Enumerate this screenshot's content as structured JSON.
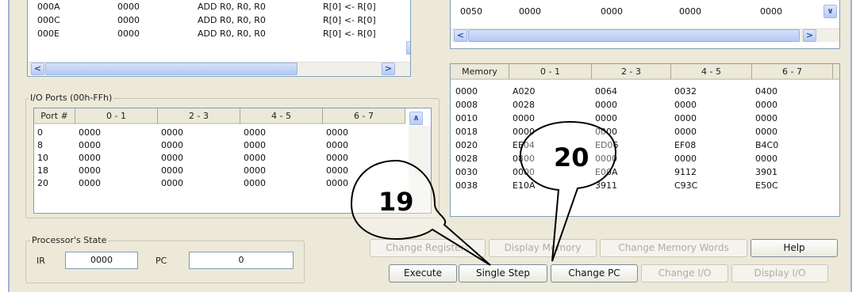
{
  "code_panel": {
    "rows": [
      {
        "addr": "000A",
        "code": "0000",
        "instr": "ADD R0, R0, R0",
        "desc": "R[0] <- R[0]"
      },
      {
        "addr": "000C",
        "code": "0000",
        "instr": "ADD R0, R0, R0",
        "desc": "R[0] <- R[0]"
      },
      {
        "addr": "000E",
        "code": "0000",
        "instr": "ADD R0, R0, R0",
        "desc": "R[0] <- R[0]"
      }
    ]
  },
  "reg_panel": {
    "row": [
      "0050",
      "0000",
      "0000",
      "0000",
      "0000"
    ]
  },
  "io_ports": {
    "title": "I/O Ports (00h-FFh)",
    "headers": [
      "Port #",
      "0 - 1",
      "2 - 3",
      "4 - 5",
      "6 - 7"
    ],
    "rows": [
      [
        "0",
        "0000",
        "0000",
        "0000",
        "0000"
      ],
      [
        "8",
        "0000",
        "0000",
        "0000",
        "0000"
      ],
      [
        "10",
        "0000",
        "0000",
        "0000",
        "0000"
      ],
      [
        "18",
        "0000",
        "0000",
        "0000",
        "0000"
      ],
      [
        "20",
        "0000",
        "0000",
        "0000",
        "0000"
      ]
    ]
  },
  "memory": {
    "headers": [
      "Memory",
      "0 - 1",
      "2 - 3",
      "4 - 5",
      "6 - 7"
    ],
    "rows": [
      [
        "0000",
        "A020",
        "0064",
        "0032",
        "0400"
      ],
      [
        "0008",
        "0028",
        "0000",
        "0000",
        "0000"
      ],
      [
        "0010",
        "0000",
        "0000",
        "0000",
        "0000"
      ],
      [
        "0018",
        "0000",
        "0000",
        "0000",
        "0000"
      ],
      [
        "0020",
        "EE04",
        "ED06",
        "EF08",
        "B4C0"
      ],
      [
        "0028",
        "0800",
        "0000",
        "0000",
        "0000"
      ],
      [
        "0030",
        "0000",
        "E00A",
        "9112",
        "3901"
      ],
      [
        "0038",
        "E10A",
        "3911",
        "C93C",
        "E50C"
      ]
    ]
  },
  "processor": {
    "title": "Processor's State",
    "ir_label": "IR",
    "ir_value": "0000",
    "pc_label": "PC",
    "pc_value": "0"
  },
  "buttons": {
    "change_registers": "Change Registers",
    "display_memory": "Display Memory",
    "change_memory_words": "Change Memory Words",
    "help": "Help",
    "execute": "Execute",
    "single_step": "Single Step",
    "change_pc": "Change PC",
    "change_io": "Change I/O",
    "display_io": "Display I/O"
  },
  "callouts": {
    "callout_19": "19",
    "callout_20": "20"
  },
  "colors": {
    "window_bg": "#ece9d8",
    "scroll_blue": "#b7caf2",
    "disabled_text": "#b2ad9c"
  }
}
